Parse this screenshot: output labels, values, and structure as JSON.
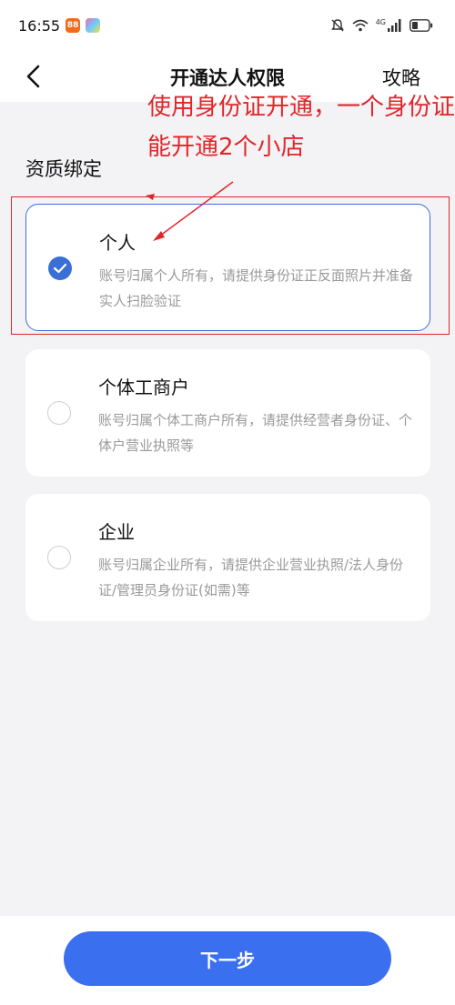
{
  "status_bar": {
    "time": "16:55",
    "app_badge_1": "88",
    "network": "4G"
  },
  "header": {
    "title": "开通达人权限",
    "guide_label": "攻略"
  },
  "annotation": {
    "text": "使用身份证开通，一个身份证能开通2个小店"
  },
  "section": {
    "title": "资质绑定"
  },
  "options": [
    {
      "title": "个人",
      "desc": "账号归属个人所有，请提供身份证正反面照片并准备实人扫脸验证",
      "selected": true
    },
    {
      "title": "个体工商户",
      "desc": "账号归属个体工商户所有，请提供经营者身份证、个体户营业执照等",
      "selected": false
    },
    {
      "title": "企业",
      "desc": "账号归属企业所有，请提供企业营业执照/法人身份证/管理员身份证(如需)等",
      "selected": false
    }
  ],
  "footer": {
    "next_label": "下一步"
  },
  "colors": {
    "primary": "#3a6ff0",
    "annotation_red": "#e0262b",
    "background": "#f3f3f5"
  }
}
